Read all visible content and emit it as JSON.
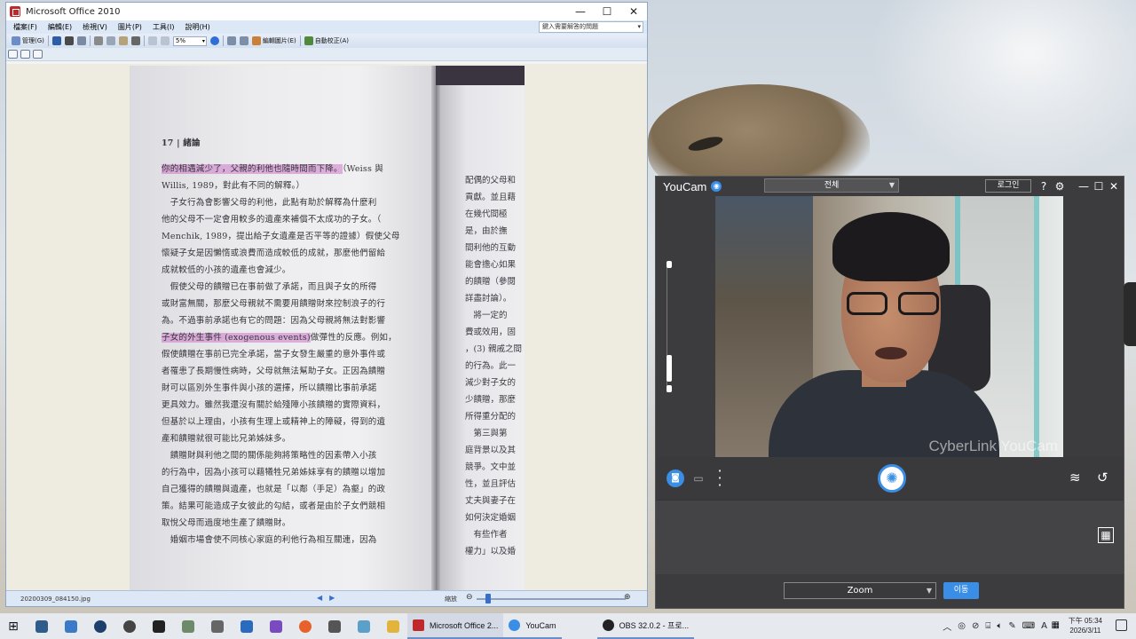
{
  "office": {
    "title": "Microsoft Office 2010",
    "menu": [
      "檔案(F)",
      "編輯(E)",
      "檢視(V)",
      "圖片(P)",
      "工具(I)",
      "說明(H)"
    ],
    "help_placeholder": "鍵入需要解答的問題",
    "toolbar": {
      "manage_label": "管理(G)",
      "zoom_value": "5%",
      "rotate_label": "編輯圖片(E)",
      "auto_label": "自動校正(A)"
    },
    "status": {
      "filename": "20200309_084150.jpg",
      "zoom_label": "縮放"
    }
  },
  "book": {
    "page_number": "17 | 緒論",
    "left_lines": [
      {
        "hl": "你的相遇減少了，父親的利他也隨時間而下降。",
        "rest": "（Weiss 與"
      },
      {
        "hl": "",
        "rest": "Willis, 1989，對此有不同的解釋。）"
      },
      {
        "hl": "",
        "rest": "　子女行為會影響父母的利他，此點有助於解釋為什麼利"
      },
      {
        "hl": "",
        "rest": "他的父母不一定會用較多的遺產來補償不太成功的子女。（"
      },
      {
        "hl": "",
        "rest": "Menchik, 1989，提出給子女遺產是否平等的證據）假使父母"
      },
      {
        "hl": "",
        "rest": "懷疑子女是因懶惰或浪費而造成較低的成就，那麼他們留給"
      },
      {
        "hl": "",
        "rest": "成就較低的小孩的遺產也會減少。"
      },
      {
        "hl": "",
        "rest": "　假使父母的饋贈已在事前做了承諾，而且與子女的所得"
      },
      {
        "hl": "",
        "rest": "或財富無關，那麼父母親就不需要用饋贈財來控制浪子的行"
      },
      {
        "hl": "",
        "rest": "為。不過事前承諾也有它的問題：因為父母親將無法對影響"
      },
      {
        "hl": "子女的外生事件 (exogenous events)",
        "rest": "做彈性的反應。例如，"
      },
      {
        "hl": "",
        "rest": "假使饋贈在事前已完全承諾，當子女發生嚴重的意外事件或"
      },
      {
        "hl": "",
        "rest": "者罹患了長期慢性病時，父母就無法幫助子女。正因為饋贈"
      },
      {
        "hl": "",
        "rest": "財可以區別外生事件與小孩的選擇，所以饋贈比事前承諾"
      },
      {
        "hl": "",
        "rest": "更具效力。雖然我還沒有關於給殘障小孩饋贈的實際資料，"
      },
      {
        "hl": "",
        "rest": "但基於以上理由，小孩有生理上或精神上的障礙，得到的遺"
      },
      {
        "hl": "",
        "rest": "產和饋贈就很可能比兄弟姊妹多。"
      },
      {
        "hl": "",
        "rest": "　饋贈財與利他之間的關係能夠將策略性的因素帶入小孩"
      },
      {
        "hl": "",
        "rest": "的行為中，因為小孩可以藉犧牲兄弟姊妹享有的饋贈以增加"
      },
      {
        "hl": "",
        "rest": "自己獲得的饋贈與遺產，也就是「以鄰（手足）為壑」的政"
      },
      {
        "hl": "",
        "rest": "策。結果可能造成子女彼此的勾結，或者是由於子女們競相"
      },
      {
        "hl": "",
        "rest": "取悅父母而過度地生產了饋贈財。"
      },
      {
        "hl": "",
        "rest": "　婚姻市場會使不同核心家庭的利他行為相互關連，因為"
      }
    ],
    "right_lines": [
      "配偶的父母和",
      "貢獻。並且藉",
      "在幾代間極",
      "是，由於撫",
      "間利他的互動",
      "能會擔心如果",
      "的饋贈（參閱",
      "詳盡討論）。",
      "　將一定的",
      "費或效用，固",
      "，(3) 親戚之間",
      "的行為。此一",
      "減少對子女的",
      "少饋贈，那麼",
      "所得重分配的",
      "　第三與第",
      "庭背景以及其",
      "競爭。文中並",
      "性，並且評估",
      "丈夫與妻子在",
      "如何決定婚姻",
      "　有些作者",
      "權力」以及婚"
    ]
  },
  "youcam": {
    "app_name": "YouCam",
    "top_select": "전체",
    "login": "로그인",
    "watermark": "CyberLink YouCam",
    "zoom_select": "Zoom",
    "move_button": "이동"
  },
  "taskbar": {
    "tasks": [
      {
        "label": "Microsoft Office 2...",
        "color": "#c0282c"
      },
      {
        "label": "YouCam",
        "color": "#3a8ee6"
      },
      {
        "label": "OBS 32.0.2 - 프로...",
        "color": "#222222"
      }
    ],
    "clock_time": "下午 05:34",
    "clock_date": "2026/3/11",
    "ime": "A"
  }
}
